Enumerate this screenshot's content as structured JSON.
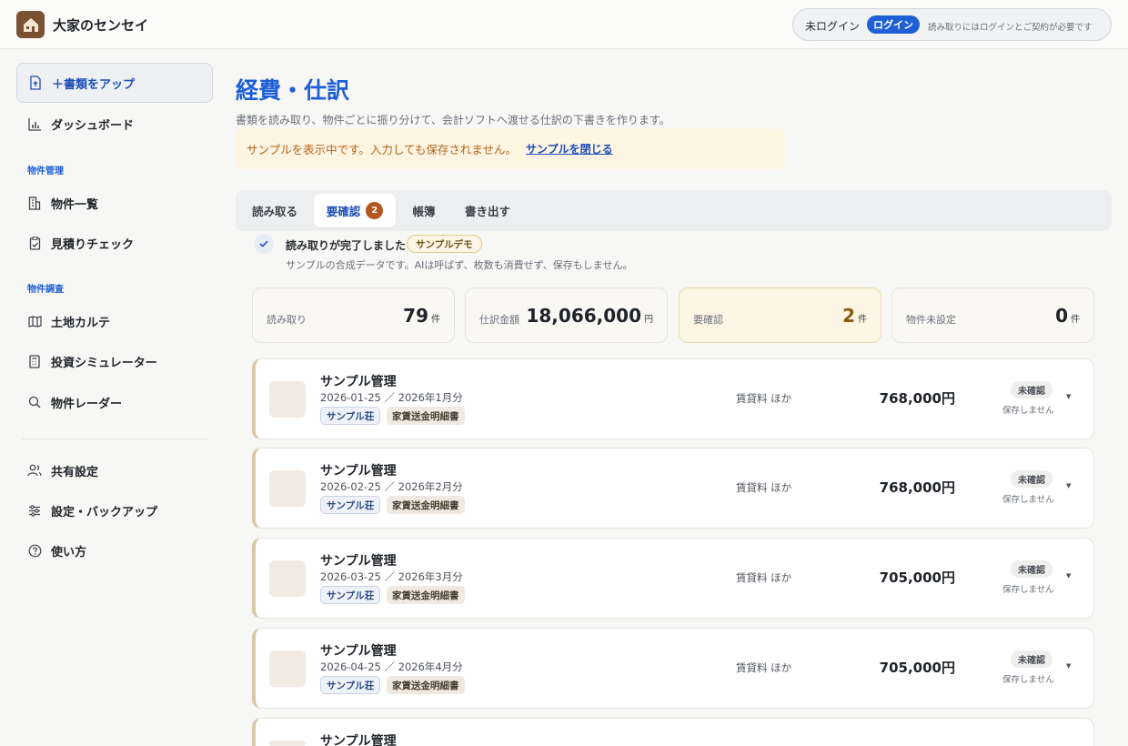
{
  "header": {
    "app_name": "大家のセンセイ",
    "login_status": "未ログイン",
    "login_button": "ログイン",
    "login_note": "読み取りにはログインとご契約が必要です"
  },
  "sidebar": {
    "upload_label": "＋書類をアップ",
    "dashboard_label": "ダッシュボード",
    "section_property": "物件管理",
    "property_list": "物件一覧",
    "estimate_check": "見積りチェック",
    "section_research": "物件調査",
    "land_karte": "土地カルテ",
    "invest_sim": "投資シミュレーター",
    "property_radar": "物件レーダー",
    "share_settings": "共有設定",
    "settings_backup": "設定・バックアップ",
    "how_to": "使い方"
  },
  "main": {
    "title": "経費・仕訳",
    "description": "書類を読み取り、物件ごとに振り分けて、会計ソフトへ渡せる仕訳の下書きを作ります。",
    "banner_text": "サンプルを表示中です。入力しても保存されません。",
    "banner_link": "サンプルを閉じる",
    "tabs": [
      {
        "label": "読み取る"
      },
      {
        "label": "要確認",
        "badge": "2"
      },
      {
        "label": "帳簿"
      },
      {
        "label": "書き出す"
      }
    ],
    "done_title": "読み取りが完了しました",
    "demo_badge": "サンプルデモ",
    "done_sub": "サンプルの合成データです。AIは呼ばず、枚数も消費せず、保存もしません。",
    "stats": [
      {
        "label": "読み取り",
        "value": "79",
        "unit": "件"
      },
      {
        "label": "仕訳金額",
        "value": "18,066,000",
        "unit": "円"
      },
      {
        "label": "要確認",
        "value": "2",
        "unit": "件"
      },
      {
        "label": "物件未設定",
        "value": "0",
        "unit": "件"
      }
    ],
    "cards": [
      {
        "title": "サンプル管理",
        "date": "2026-01-25 ／ 2026年1月分",
        "tag1": "サンプル荘",
        "tag2": "家賃送金明細書",
        "kind": "賃貸料 ほか",
        "amount": "768,000円",
        "status": "未確認",
        "save": "保存しません"
      },
      {
        "title": "サンプル管理",
        "date": "2026-02-25 ／ 2026年2月分",
        "tag1": "サンプル荘",
        "tag2": "家賃送金明細書",
        "kind": "賃貸料 ほか",
        "amount": "768,000円",
        "status": "未確認",
        "save": "保存しません"
      },
      {
        "title": "サンプル管理",
        "date": "2026-03-25 ／ 2026年3月分",
        "tag1": "サンプル荘",
        "tag2": "家賃送金明細書",
        "kind": "賃貸料 ほか",
        "amount": "705,000円",
        "status": "未確認",
        "save": "保存しません"
      },
      {
        "title": "サンプル管理",
        "date": "2026-04-25 ／ 2026年4月分",
        "tag1": "サンプル荘",
        "tag2": "家賃送金明細書",
        "kind": "賃貸料 ほか",
        "amount": "705,000円",
        "status": "未確認",
        "save": "保存しません"
      },
      {
        "title": "サンプル管理"
      }
    ]
  },
  "colors": {
    "accent": "#1e5fd6",
    "badge": "#b4541e",
    "banner_bg": "#fdf4e2",
    "warn_text": "#b3661a"
  }
}
